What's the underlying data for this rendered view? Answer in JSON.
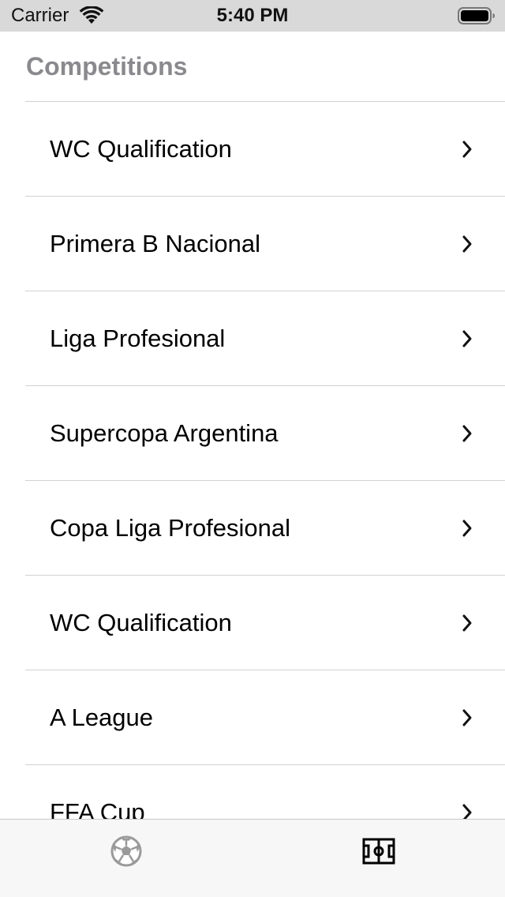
{
  "status_bar": {
    "carrier": "Carrier",
    "time": "5:40 PM",
    "wifi_icon": "wifi-icon",
    "battery_icon": "battery-icon"
  },
  "header": {
    "title": "Competitions"
  },
  "competitions": [
    {
      "label": "WC Qualification"
    },
    {
      "label": "Primera B Nacional"
    },
    {
      "label": "Liga Profesional"
    },
    {
      "label": "Supercopa Argentina"
    },
    {
      "label": "Copa Liga Profesional"
    },
    {
      "label": "WC Qualification"
    },
    {
      "label": "A League"
    },
    {
      "label": "FFA Cup"
    }
  ],
  "tab_bar": {
    "tabs": [
      {
        "icon": "soccer-ball-icon",
        "selected": false
      },
      {
        "icon": "football-field-icon",
        "selected": true
      }
    ]
  },
  "colors": {
    "status_bar_bg": "#d9d9d9",
    "title": "#8a8a8e",
    "divider": "#d2d2d6",
    "tab_bar_bg": "#f7f7f7",
    "tab_inactive": "#9a9a9a",
    "tab_active": "#000000"
  }
}
